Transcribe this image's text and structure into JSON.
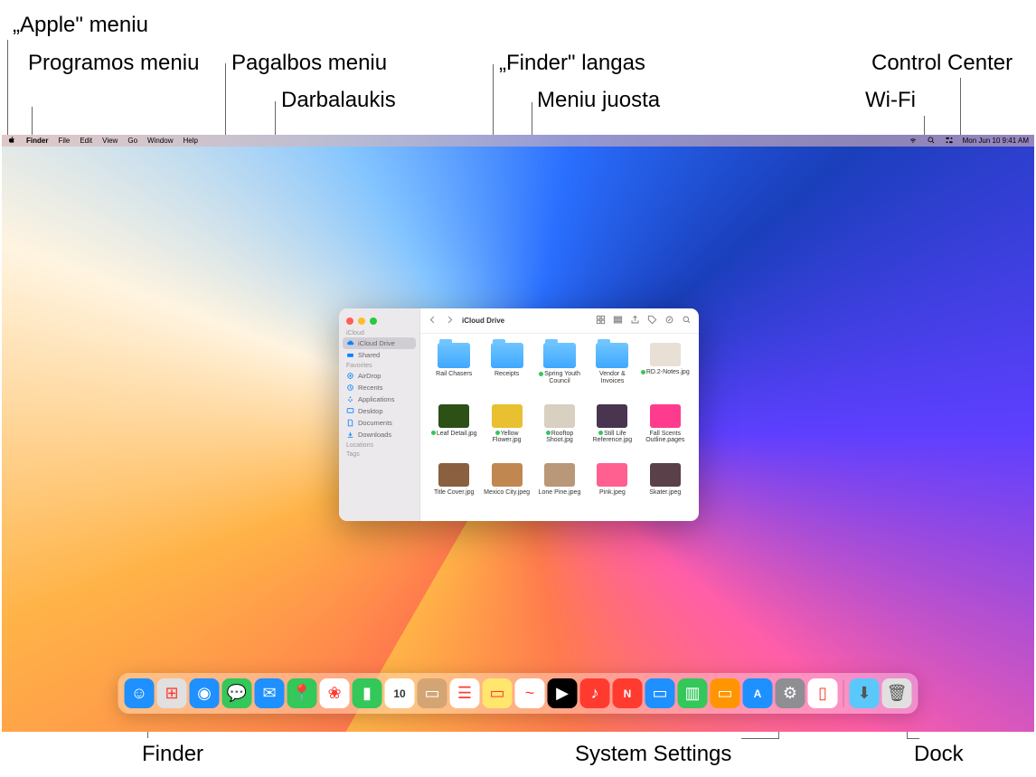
{
  "callouts": {
    "apple_menu": "„Apple\" meniu",
    "app_menu": "Programos meniu",
    "help_menu": "Pagalbos meniu",
    "desktop": "Darbalaukis",
    "finder_window": "„Finder\" langas",
    "menu_bar": "Meniu juosta",
    "control_center": "Control Center",
    "wifi": "Wi-Fi",
    "finder": "Finder",
    "system_settings": "System Settings",
    "dock": "Dock"
  },
  "menubar": {
    "app": "Finder",
    "items": [
      "File",
      "Edit",
      "View",
      "Go",
      "Window",
      "Help"
    ],
    "datetime": "Mon Jun 10  9:41 AM"
  },
  "finder": {
    "title": "iCloud Drive",
    "sidebar": {
      "sections": [
        {
          "label": "iCloud",
          "items": [
            {
              "name": "iCloud Drive",
              "icon": "cloud",
              "selected": true
            },
            {
              "name": "Shared",
              "icon": "shared"
            }
          ]
        },
        {
          "label": "Favorites",
          "items": [
            {
              "name": "AirDrop",
              "icon": "airdrop"
            },
            {
              "name": "Recents",
              "icon": "clock"
            },
            {
              "name": "Applications",
              "icon": "apps"
            },
            {
              "name": "Desktop",
              "icon": "desktop"
            },
            {
              "name": "Documents",
              "icon": "doc"
            },
            {
              "name": "Downloads",
              "icon": "download"
            }
          ]
        },
        {
          "label": "Locations",
          "items": []
        },
        {
          "label": "Tags",
          "items": []
        }
      ]
    },
    "files": [
      {
        "name": "Rail Chasers",
        "type": "folder"
      },
      {
        "name": "Receipts",
        "type": "folder"
      },
      {
        "name": "Spring Youth Council",
        "type": "folder",
        "tag": "green"
      },
      {
        "name": "Vendor & Invoices",
        "type": "folder"
      },
      {
        "name": "RD.2-Notes.jpg",
        "type": "img",
        "tag": "green",
        "color": "#e8e0d5"
      },
      {
        "name": "Leaf Detail.jpg",
        "type": "img",
        "tag": "green",
        "color": "#2d5016"
      },
      {
        "name": "Yellow Flower.jpg",
        "type": "img",
        "tag": "green",
        "color": "#e8c030"
      },
      {
        "name": "Rooftop Shoot.jpg",
        "type": "img",
        "tag": "green",
        "color": "#d8d0c0"
      },
      {
        "name": "Still Life Reference.jpg",
        "type": "img",
        "tag": "green",
        "color": "#4a3550"
      },
      {
        "name": "Fall Scents Outline.pages",
        "type": "img",
        "color": "#ff3b8d"
      },
      {
        "name": "Title Cover.jpg",
        "type": "img",
        "color": "#8a6040"
      },
      {
        "name": "Mexico City.jpeg",
        "type": "img",
        "color": "#c08850"
      },
      {
        "name": "Lone Pine.jpeg",
        "type": "img",
        "color": "#b89878"
      },
      {
        "name": "Pink.jpeg",
        "type": "img",
        "color": "#ff6090"
      },
      {
        "name": "Skater.jpeg",
        "type": "img",
        "color": "#5a4048"
      }
    ]
  },
  "dock": {
    "apps": [
      {
        "name": "Finder",
        "color": "#1e90ff",
        "glyph": "☺"
      },
      {
        "name": "Launchpad",
        "color": "#e0e0e0",
        "glyph": "⊞"
      },
      {
        "name": "Safari",
        "color": "#1e90ff",
        "glyph": "◉"
      },
      {
        "name": "Messages",
        "color": "#34c759",
        "glyph": "💬"
      },
      {
        "name": "Mail",
        "color": "#1e90ff",
        "glyph": "✉"
      },
      {
        "name": "Maps",
        "color": "#34c759",
        "glyph": "📍"
      },
      {
        "name": "Photos",
        "color": "#fff",
        "glyph": "❀"
      },
      {
        "name": "FaceTime",
        "color": "#34c759",
        "glyph": "▮"
      },
      {
        "name": "Calendar",
        "color": "#fff",
        "glyph": "10",
        "text": true
      },
      {
        "name": "Contacts",
        "color": "#d4a574",
        "glyph": "▭"
      },
      {
        "name": "Reminders",
        "color": "#fff",
        "glyph": "☰"
      },
      {
        "name": "Notes",
        "color": "#ffe66d",
        "glyph": "▭"
      },
      {
        "name": "Freeform",
        "color": "#fff",
        "glyph": "~"
      },
      {
        "name": "TV",
        "color": "#000",
        "glyph": "▶"
      },
      {
        "name": "Music",
        "color": "#ff3b30",
        "glyph": "♪"
      },
      {
        "name": "News",
        "color": "#ff3b30",
        "glyph": "N",
        "text": true
      },
      {
        "name": "Keynote",
        "color": "#1e90ff",
        "glyph": "▭"
      },
      {
        "name": "Numbers",
        "color": "#34c759",
        "glyph": "▥"
      },
      {
        "name": "Pages",
        "color": "#ff9500",
        "glyph": "▭"
      },
      {
        "name": "App Store",
        "color": "#1e90ff",
        "glyph": "A",
        "text": true
      },
      {
        "name": "System Settings",
        "color": "#8e8e93",
        "glyph": "⚙"
      },
      {
        "name": "iPhone Mirroring",
        "color": "#fff",
        "glyph": "▯"
      }
    ],
    "extras": [
      {
        "name": "Downloads",
        "color": "#5ac8fa",
        "glyph": "⬇"
      },
      {
        "name": "Trash",
        "color": "#e0e0e0",
        "glyph": "🗑"
      }
    ]
  }
}
